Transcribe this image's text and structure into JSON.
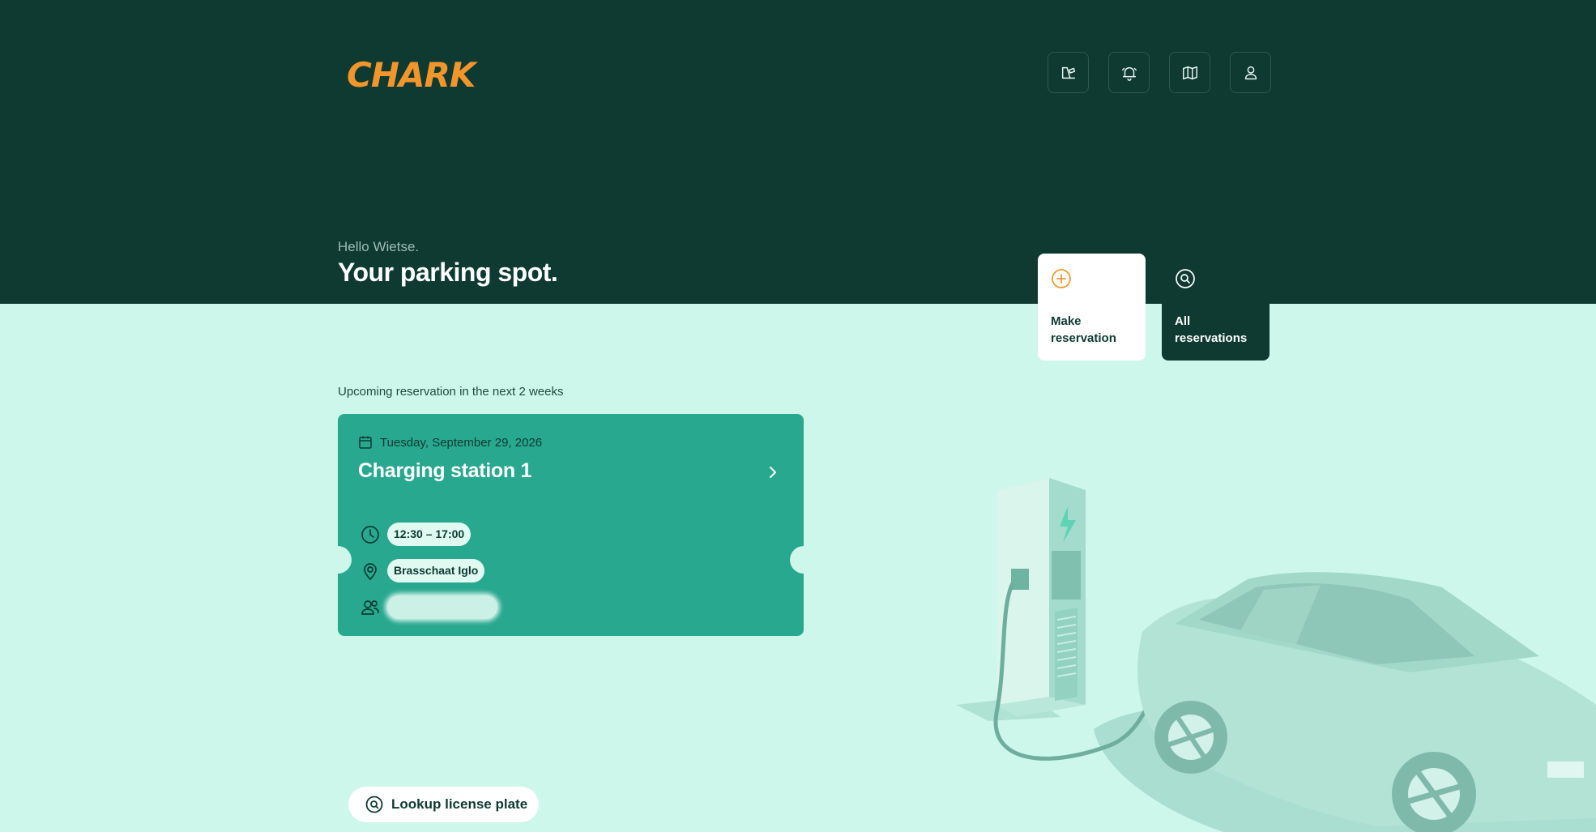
{
  "brand": {
    "logo_text": "CHARK",
    "accent": "#f2952b",
    "dark": "#0e3a31",
    "teal": "#28a88f",
    "mint": "#cdf7ea"
  },
  "header": {
    "icons": [
      {
        "name": "spot-icon"
      },
      {
        "name": "bell-icon"
      },
      {
        "name": "map-icon"
      },
      {
        "name": "user-icon"
      }
    ],
    "greeting": "Hello Wietse.",
    "title": "Your parking spot."
  },
  "actions": {
    "make": {
      "label": "Make reservation",
      "icon": "plus-circle-icon"
    },
    "all": {
      "label": "All reservations",
      "icon": "search-circle-icon"
    }
  },
  "upcoming": {
    "label": "Upcoming reservation in the next 2 weeks",
    "reservation": {
      "date": "Tuesday, September 29, 2026",
      "station": "Charging station 1",
      "time": "12:30 – 17:00",
      "location": "Brasschaat Iglo",
      "guests": ""
    }
  },
  "lookup": {
    "label": "Lookup license plate"
  }
}
